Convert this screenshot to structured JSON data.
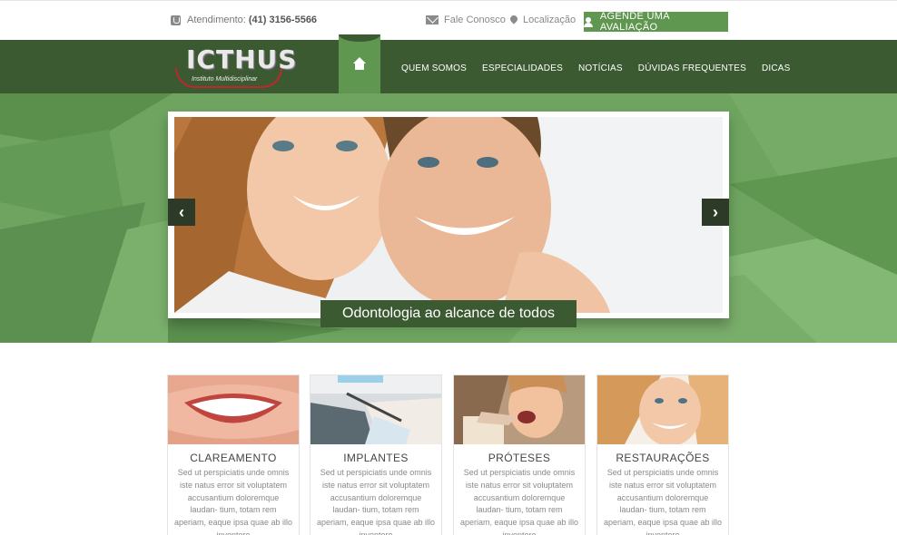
{
  "topbar": {
    "attend_label": "Atendimento:",
    "attend_phone": "(41) 3156-5566",
    "contact_label": "Fale Conosco",
    "location_label": "Localização",
    "cta_label": "AGENDE UMA AVALIAÇÃO",
    "icons": [
      "phone-icon",
      "mail-icon",
      "location-pin-icon",
      "user-icon"
    ]
  },
  "brand": {
    "name": "ICTHUS",
    "tagline": "Instituto Multidisciplinar"
  },
  "nav": {
    "home_icon": "home-icon",
    "items": [
      {
        "label": "QUEM SOMOS"
      },
      {
        "label": "ESPECIALIDADES"
      },
      {
        "label": "NOTÍCIAS"
      },
      {
        "label": "DÚVIDAS FREQUENTES"
      },
      {
        "label": "DICAS"
      }
    ]
  },
  "hero": {
    "caption": "Odontologia ao alcance de todos",
    "prev_icon": "chevron-left-icon",
    "next_icon": "chevron-right-icon"
  },
  "services": [
    {
      "title": "CLAREAMENTO",
      "text": "Sed ut perspiciatis unde omnis iste natus error sit voluptatem accusantium doloremque laudan- tium, totam rem aperiam, eaque ipsa quae ab illo inventore"
    },
    {
      "title": "IMPLANTES",
      "text": "Sed ut perspiciatis unde omnis iste natus error sit voluptatem accusantium doloremque laudan- tium, totam rem aperiam, eaque ipsa quae ab illo inventore"
    },
    {
      "title": "PRÓTESES",
      "text": "Sed ut perspiciatis unde omnis iste natus error sit voluptatem accusantium doloremque laudan- tium, totam rem aperiam, eaque ipsa quae ab illo inventore"
    },
    {
      "title": "RESTAURAÇÕES",
      "text": "Sed ut perspiciatis unde omnis iste natus error sit voluptatem accusantium doloremque laudan- tium, totam rem aperiam, eaque ipsa quae ab illo inventore"
    }
  ],
  "colors": {
    "brand_dark": "#3b5a31",
    "brand_green": "#5f9650",
    "hero_green": "#6ea460",
    "logo_red": "#c0272d"
  }
}
